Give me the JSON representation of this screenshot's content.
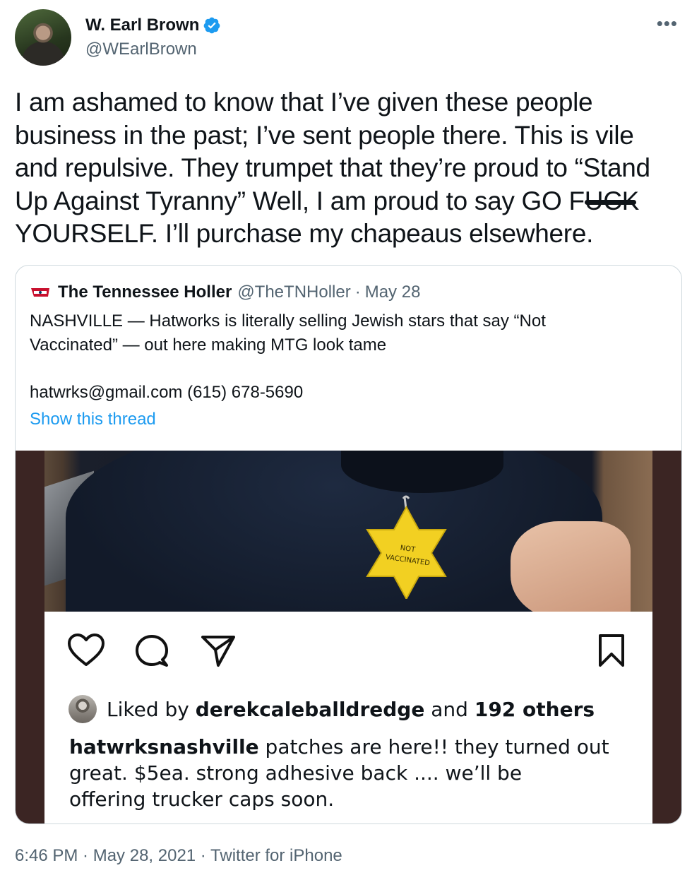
{
  "author": {
    "name": "W. Earl Brown",
    "handle": "@WEarlBrown",
    "verified_icon": "verified-badge-icon",
    "more_icon": "more-horizontal-icon"
  },
  "tweet": {
    "text": "I am ashamed to know that I’ve given these people\nbusiness in the past; I’ve sent people there. This is vile\nand repulsive. They trumpet that they’re proud to “Stand\nUp Against Tyranny” Well, I am proud to say GO F\nYOURSELF. I’ll purchase my chapeaus elsewhere.",
    "censored_word": "UCK",
    "footer": "6:46 PM · May 28, 2021 · Twitter for iPhone"
  },
  "quote": {
    "name": "The Tennessee Holler",
    "handle": "@TheTNHoller",
    "separator": "·",
    "date": "May 28",
    "logo_text": "TN HOLLER",
    "text": "NASHVILLE — Hatworks is literally selling Jewish stars that say “Not\nVaccinated” — out here making MTG look tame\n\nhatwrks@gmail.com (615) 678-5690",
    "show_thread": "Show this thread"
  },
  "media": {
    "star_text_line1": "NOT",
    "star_text_line2": "VACCINATED",
    "instagram": {
      "icons": [
        "heart-icon",
        "comment-icon",
        "share-icon",
        "bookmark-icon"
      ],
      "liked_by_prefix": "Liked by",
      "liked_by_user": "derekcaleballdredge",
      "liked_by_and": "and",
      "liked_by_others": "192 others",
      "caption_user": "hatwrksnashville",
      "caption_text": " patches are here!! they turned out\ngreat. $5ea. strong adhesive back .... we’ll be\noffering trucker caps soon."
    }
  },
  "colors": {
    "link": "#1d9bf0",
    "secondary_text": "#536471",
    "verified": "#1d9bf0",
    "media_border": "#3b2523",
    "star": "#f2d022"
  }
}
